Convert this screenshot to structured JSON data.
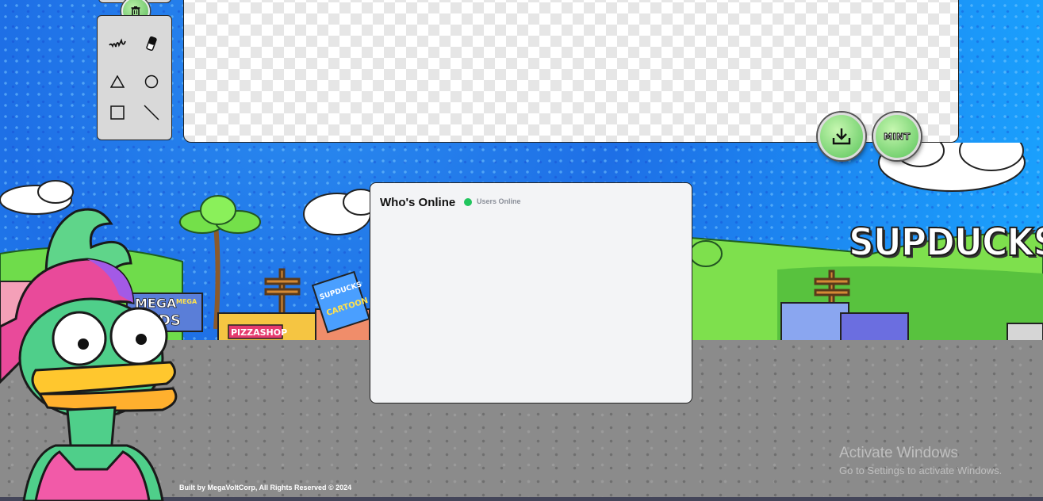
{
  "toolbar": {
    "tools": [
      {
        "id": "pen",
        "icon": "squiggle-pen-icon"
      },
      {
        "id": "eraser",
        "icon": "eraser-icon"
      },
      {
        "id": "triangle",
        "icon": "triangle-icon"
      },
      {
        "id": "circle",
        "icon": "circle-icon"
      },
      {
        "id": "square",
        "icon": "square-icon"
      },
      {
        "id": "line",
        "icon": "line-icon"
      }
    ],
    "clear_icon": "trash-icon"
  },
  "actions": {
    "download_icon": "download-icon",
    "mint_label": "MINT"
  },
  "online": {
    "title": "Who's Online",
    "status_label": "Users Online",
    "status_color": "#22c55e"
  },
  "scene": {
    "brand": "SUPDUCKS",
    "sign_mega_line1": "MEGA",
    "sign_mega_small": "MEGA",
    "sign_mega_line2": "DS",
    "sign_pizza": "PIZZASHOP",
    "sign_book_line1": "SUPDUCKS",
    "sign_book_line2": "CARTOON"
  },
  "footer": {
    "copyright": "Built by MegaVoltCorp, All Rights Reserved © 2024"
  },
  "watermark": {
    "title": "Activate Windows",
    "subtitle": "Go to Settings to activate Windows."
  },
  "colors": {
    "sky": "#1e6fe6",
    "ground": "#8b8b8b",
    "panel": "#f3f4f6",
    "button_green": "#59c45a"
  }
}
